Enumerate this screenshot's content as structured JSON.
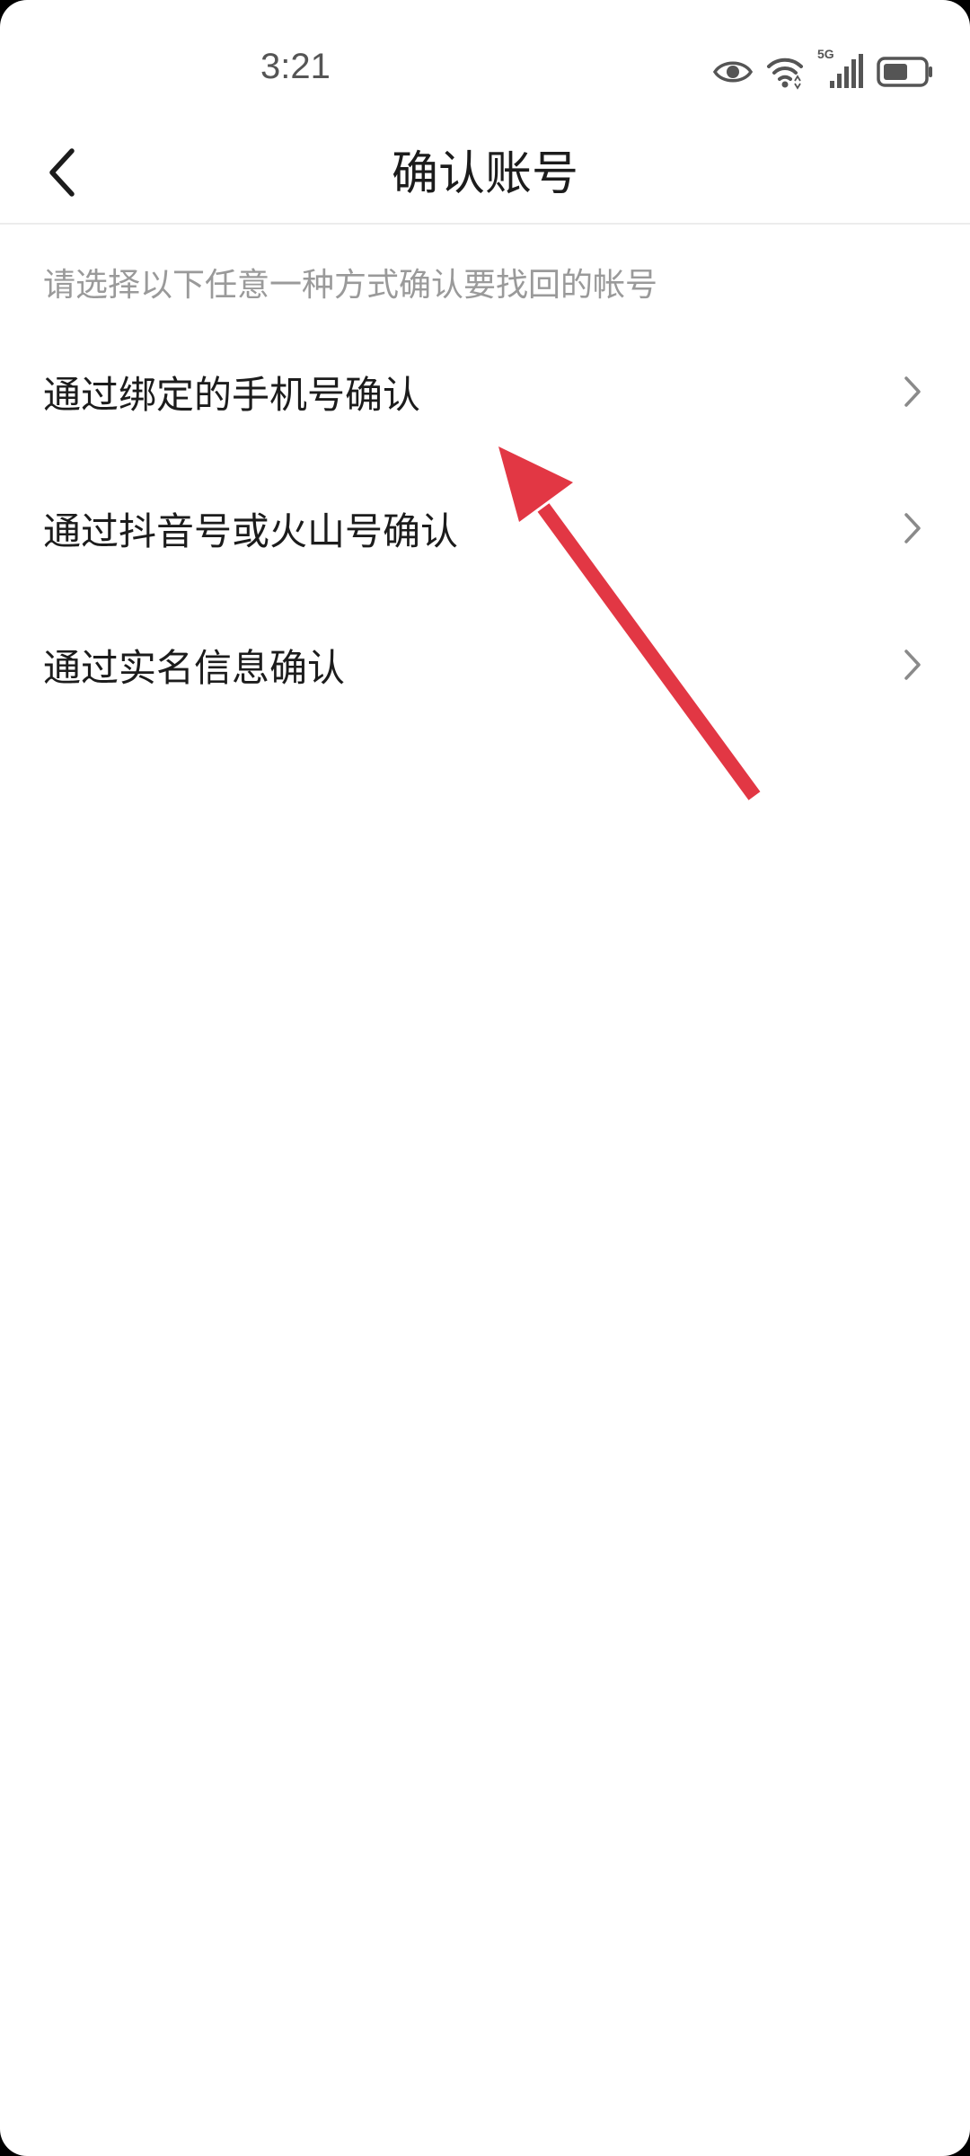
{
  "status_bar": {
    "time": "3:21",
    "network_label": "5G"
  },
  "header": {
    "title": "确认账号"
  },
  "instruction": "请选择以下任意一种方式确认要找回的帐号",
  "options": [
    {
      "label": "通过绑定的手机号确认"
    },
    {
      "label": "通过抖音号或火山号确认"
    },
    {
      "label": "通过实名信息确认"
    }
  ],
  "colors": {
    "annotation_arrow": "#e23744",
    "title_text": "#1c1c1c",
    "hint_text": "#9a9a9a",
    "chevron": "#8a8a8a"
  },
  "icons": [
    "eye-icon",
    "wifi-icon",
    "cellular-signal-icon",
    "battery-icon",
    "back-arrow-icon",
    "chevron-right-icon"
  ]
}
